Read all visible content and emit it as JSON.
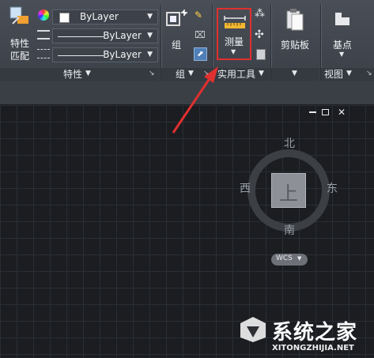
{
  "ribbon": {
    "properties": {
      "match_label_line1": "特性",
      "match_label_line2": "匹配",
      "color_value": "ByLayer",
      "linetype_value": "ByLayer",
      "lineweight_value": "ByLayer",
      "panel_title": "特性"
    },
    "groups": {
      "group_label": "组",
      "panel_title": "组"
    },
    "utilities": {
      "measure_label": "测量",
      "panel_title": "实用工具"
    },
    "clipboard": {
      "label": "剪贴板"
    },
    "view": {
      "base_label": "基点",
      "panel_title": "视图"
    }
  },
  "viewcube": {
    "north": "北",
    "south": "南",
    "east": "东",
    "west": "西",
    "face": "上",
    "wcs": "WCS"
  },
  "watermark": {
    "brand": "系统之家",
    "url": "XITONGZHIJIA.NET"
  },
  "colors": {
    "highlight": "#e0302f",
    "accent": "#ffcc33",
    "canvas": "#1b1d21"
  }
}
